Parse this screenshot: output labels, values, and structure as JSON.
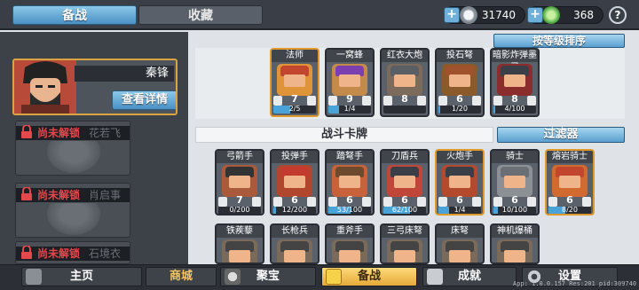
{
  "tabs": [
    {
      "label": "备战"
    },
    {
      "label": "收藏"
    }
  ],
  "currency": {
    "silver": "31740",
    "gems": "368"
  },
  "hero": {
    "name": "秦锋",
    "details_button": "查看详情"
  },
  "locked_heroes": [
    {
      "status": "尚未解锁",
      "name": "花若飞"
    },
    {
      "status": "尚未解锁",
      "name": "肖启事"
    },
    {
      "status": "尚未解锁",
      "name": "石境衣"
    }
  ],
  "sort_button": "按等级排序",
  "section_title": "战斗卡牌",
  "filter_button": "过滤器",
  "deck_cards": [
    {
      "name": "法师",
      "level": "7",
      "progress": "2/5",
      "gold": true,
      "hat": "#c2452e",
      "art": "#e0943a",
      "fill": 0.4
    },
    {
      "name": "一窝蜂",
      "level": "9",
      "progress": "1/4",
      "gold": false,
      "hat": "#7b3fb0",
      "art": "#c48a4a",
      "fill": 0.25
    },
    {
      "name": "红衣大炮",
      "level": "8",
      "progress": "",
      "gold": false,
      "hat": "#5a5f66",
      "art": "#7c6a5a",
      "fill": 0
    },
    {
      "name": "投石弩",
      "level": "6",
      "progress": "1/20",
      "gold": false,
      "hat": "#a0522d",
      "art": "#8b5a2b",
      "fill": 0.05
    },
    {
      "name": "暗影炸弹墨灵",
      "level": "8",
      "progress": "4/100",
      "gold": false,
      "hat": "#3a3f47",
      "art": "#8c2d2d",
      "fill": 0.04
    }
  ],
  "battle_cards": [
    {
      "name": "弓箭手",
      "level": "7",
      "progress": "0/200",
      "gold": false,
      "hat": "#333",
      "art": "#a85a3a",
      "fill": 0
    },
    {
      "name": "投弹手",
      "level": "6",
      "progress": "12/200",
      "gold": false,
      "hat": "#c23b2e",
      "art": "#b0462e",
      "fill": 0.06
    },
    {
      "name": "踏弩手",
      "level": "6",
      "progress": "53/100",
      "gold": false,
      "hat": "#6b4a2e",
      "art": "#c7623a",
      "fill": 0.53
    },
    {
      "name": "刀盾兵",
      "level": "6",
      "progress": "62/100",
      "gold": false,
      "hat": "#3a3f47",
      "art": "#c0463a",
      "fill": 0.62
    },
    {
      "name": "火炮手",
      "level": "6",
      "progress": "1/4",
      "gold": true,
      "hat": "#3a3f47",
      "art": "#b34a2e",
      "fill": 0.25
    },
    {
      "name": "骑士",
      "level": "6",
      "progress": "10/100",
      "gold": false,
      "hat": "#6a6f76",
      "art": "#8c8f94",
      "fill": 0.1
    },
    {
      "name": "熔岩骑士",
      "level": "6",
      "progress": "8/20",
      "gold": true,
      "hat": "#c2452e",
      "art": "#d06a2e",
      "fill": 0.4
    }
  ],
  "partial_cards": [
    {
      "name": "铁蒺藜"
    },
    {
      "name": "长枪兵"
    },
    {
      "name": "重斧手"
    },
    {
      "name": "三弓床弩"
    },
    {
      "name": "床弩"
    },
    {
      "name": "神机爆桶"
    }
  ],
  "nav": [
    {
      "label": "主页"
    },
    {
      "label": "商城"
    },
    {
      "label": "聚宝"
    },
    {
      "label": "备战"
    },
    {
      "label": "成就"
    },
    {
      "label": "设置"
    }
  ],
  "version": "App: 1.0.0.157 Res:201 pid:309740"
}
